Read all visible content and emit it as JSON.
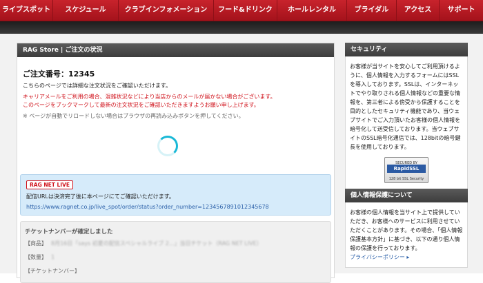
{
  "nav": {
    "items": [
      "ライブスポット",
      "スケジュール",
      "クラブインフォメーション",
      "フード&ドリンク",
      "ホールレンタル",
      "ブライダル",
      "アクセス",
      "サポート"
    ]
  },
  "main": {
    "header": "RAG Store | ご注文の状況",
    "order_label": "ご注文番号：12345",
    "desc": "こちらのページでは詳細な注文状況をご確認いただけます。",
    "warning1": "キャリアメールをご利用の場合、混雑状況などにより当店からのメールが届かない場合がございます。",
    "warning2": "このページをブックマークして最新の注文状況をご確認いただきますようお願い申し上げます。",
    "note": "※ ページが自動でリロードしない場合はブラウザの再読み込みボタンを押してください。",
    "info": {
      "badge": "RAG NET LIVE",
      "text": "配信URLは決済完了後に本ページにてご確認いただけます。",
      "url": "https://www.ragnet.co.jp/live_spot/order/status?order_number=1234567891012345678"
    },
    "ticket": {
      "title": "チケットナンバーが確定しました",
      "product_label": "【商品】",
      "product_value": "8月16日「says 初夏の配信スペシャルライブ 2...」当日チケット（RAG NET LIVE）",
      "qty_label": "【数量】",
      "qty_value": "1",
      "number_label": "【チケットナンバー】"
    }
  },
  "sidebar": {
    "security": {
      "header": "セキュリティ",
      "body": "お客様が当サイトを安心してご利用頂けるように、個人情報を入力するフォームにはSSLを導入しております。SSLは、インターネットでやり取りされる個人情報などの重要な情報を、第三者による傍受から保護することを目的としたセキュリティ機能であり、当ウェブサイトでご入力頂いたお客様の個人情報を暗号化して送受信しております。当ウェブサイトのSSL暗号化通信では、128bitの暗号鍵長を使用しております。",
      "seal_top": "SECURED BY",
      "seal_mid": "RapidSSL",
      "seal_bot": "128 bit SSL Security"
    },
    "privacy": {
      "header": "個人情報保護について",
      "body": "お客様の個人情報を当サイト上で提供していただき、お客様へのサービスに利用させていただくことがあります。その場合、「個人情報保護基本方針」に基づき、以下の通り個人情報の保護を行っております。",
      "link": "プライバシーポリシー ▸"
    }
  }
}
